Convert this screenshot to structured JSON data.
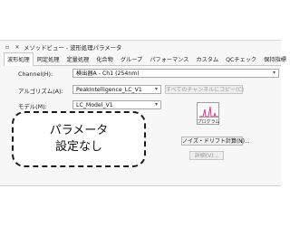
{
  "window": {
    "title": "メソッドビュー - 波形処理パラメータ",
    "pin_icon": "pin-icon",
    "close_icon": "close-icon"
  },
  "tabs": [
    {
      "label": "波形処理",
      "active": true
    },
    {
      "label": "同定処理",
      "active": false
    },
    {
      "label": "定量処理",
      "active": false
    },
    {
      "label": "化合物",
      "active": false
    },
    {
      "label": "グループ",
      "active": false
    },
    {
      "label": "パフォーマンス",
      "active": false
    },
    {
      "label": "カスタム",
      "active": false
    },
    {
      "label": "QCチェック",
      "active": false
    },
    {
      "label": "保持指標",
      "active": false
    }
  ],
  "form": {
    "channel_label": "Channel(H):",
    "channel_value": "検出器A - Ch1 (254nm)",
    "algorithm_label": "アルゴリズム(A):",
    "algorithm_value": "PeakIntelligence_LC_V1",
    "apply_all_button": "すべてのチャンネルにコピー(C)",
    "model_label": "モデル(M):",
    "model_value": "LC_Model_V1",
    "program_button": "プログラム",
    "noise_button": "ノイズ・ドリフト計算(N)...",
    "detail_button": "詳細(V)..."
  },
  "note": {
    "line1": "パラメータ",
    "line2": "設定なし"
  }
}
